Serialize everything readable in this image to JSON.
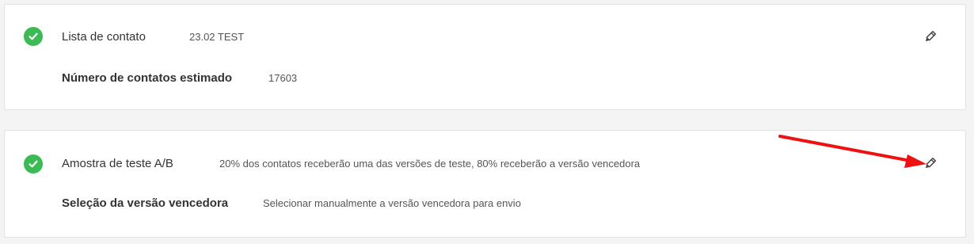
{
  "card_contact_list": {
    "status_icon": "check-circle-icon",
    "list_label": "Lista de contato",
    "list_value": "23.02 TEST",
    "count_label": "Número de contatos estimado",
    "count_value": "17603",
    "edit_icon": "pencil-icon"
  },
  "card_ab_test": {
    "status_icon": "check-circle-icon",
    "sample_label": "Amostra de teste A/B",
    "sample_value": "20% dos contatos receberão uma das versões de teste, 80% receberão a versão vencedora",
    "winner_label": "Seleção da versão vencedora",
    "winner_value": "Selecionar manualmente a versão vencedora para envio",
    "edit_icon": "pencil-icon"
  },
  "annotation": {
    "arrow_color": "#ee1111",
    "icon_name": "red-arrow-annotation"
  },
  "colors": {
    "success_green": "#3cba54",
    "text_primary": "#333333",
    "text_secondary": "#555555",
    "card_border": "#e3e3e3",
    "background": "#f4f4f4"
  }
}
